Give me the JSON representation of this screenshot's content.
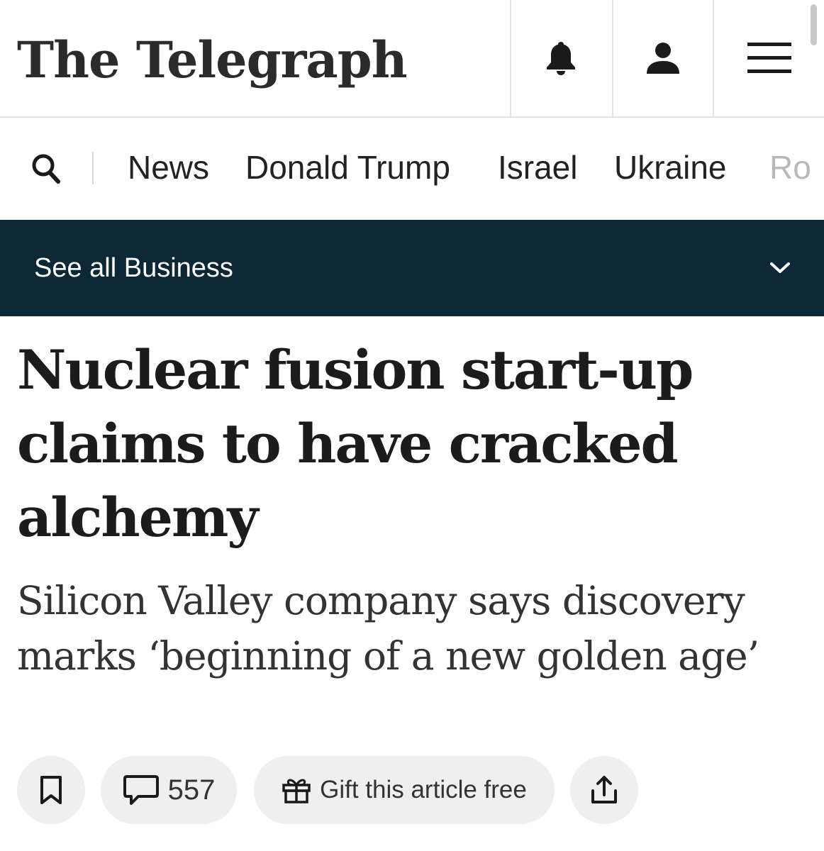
{
  "masthead": {
    "logo_text": "The Telegraph",
    "icons": [
      "bell-icon",
      "user-icon",
      "menu-icon"
    ]
  },
  "nav": {
    "search_icon": "search-icon",
    "items": [
      "News",
      "Donald Trump",
      "Israel",
      "Ukraine"
    ],
    "overflow_item": "Ro"
  },
  "section_bar": {
    "label": "See all Business",
    "icon": "chevron-down-icon",
    "background": "#0c2837"
  },
  "article": {
    "headline": "Nuclear fusion start-up claims to have cracked alchemy",
    "subheadline": "Silicon Valley company says discovery marks ‘beginning of a new golden age’"
  },
  "actions": {
    "save_icon": "bookmark-icon",
    "comment_icon": "comment-icon",
    "comment_count": "557",
    "gift_icon": "gift-icon",
    "gift_label": "Gift this article free",
    "share_icon": "share-icon"
  }
}
